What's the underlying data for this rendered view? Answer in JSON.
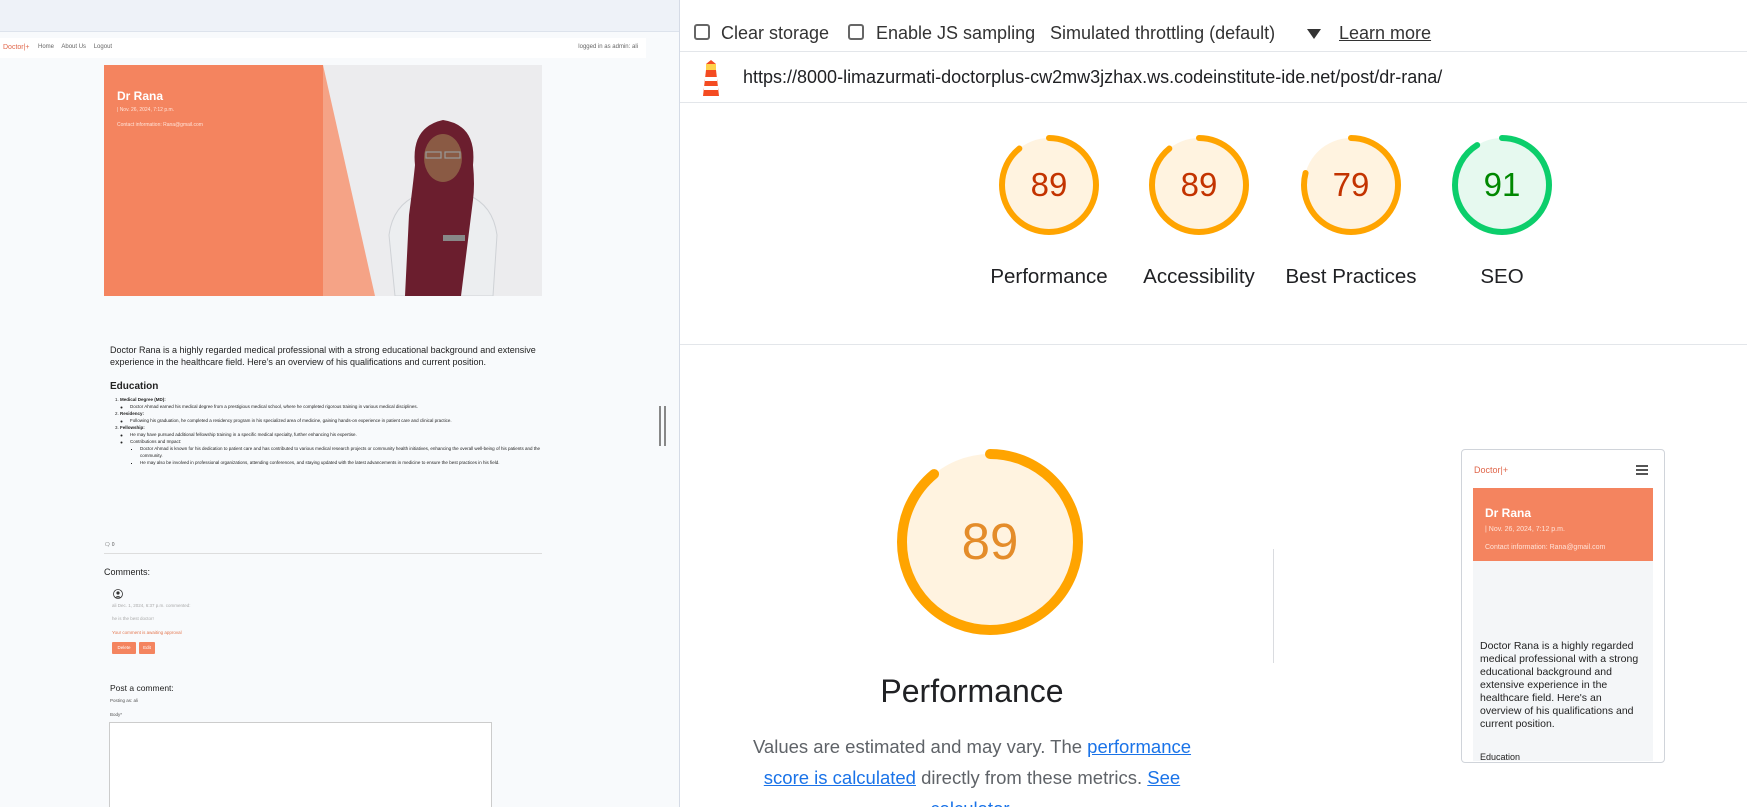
{
  "preview": {
    "nav": {
      "brand": "Doctor|+",
      "links": [
        "Home",
        "About Us",
        "Logout"
      ],
      "login_status": "logged in as admin: ali"
    },
    "hero": {
      "title": "Dr Rana",
      "date": "| Nov. 26, 2024, 7:12 p.m.",
      "contact": "Contact information: Rana@gmail.com"
    },
    "article": {
      "intro": "Doctor Rana is a highly regarded medical professional with a strong educational background and extensive experience in the healthcare field. Here’s an overview of his qualifications and current position.",
      "education_heading": "Education",
      "items": [
        {
          "title": "Medical Degree (MD):",
          "text": "Doctor Ahmad earned his medical degree from a prestigious medical school, where he completed rigorous training in various medical disciplines."
        },
        {
          "title": "Residency:",
          "text": "Following his graduation, he completed a residency program in his specialized area of medicine, gaining hands-on experience in patient care and clinical practice."
        },
        {
          "title": "Fellowship:",
          "text": "He may have pursued additional fellowship training in a specific medical specialty, further enhancing his expertise."
        }
      ],
      "contributions_heading": "Contributions and Impact:",
      "contributions": [
        "Doctor Ahmad is known for his dedication to patient care and has contributed to various medical research projects or community health initiatives, enhancing the overall well-being of his patients and the community.",
        "He may also be involved in professional organizations, attending conferences, and staying updated with the latest advancements in medicine to ensure the best practices in his field."
      ]
    },
    "likes": "0",
    "comments": {
      "heading": "Comments:",
      "meta": "ali Dec. 1, 2024, 6:37 p.m. commented:",
      "body": "he is the best doctor!",
      "awaiting": "Your comment is awaiting approval",
      "delete_label": "Delete",
      "edit_label": "Edit"
    },
    "post_comment": {
      "heading": "Post a comment:",
      "posting_as": "Posting as: ali",
      "body_label": "Body*"
    }
  },
  "lighthouse": {
    "options": {
      "clear_storage": "Clear storage",
      "enable_js_sampling": "Enable JS sampling",
      "throttling": "Simulated throttling (default)",
      "learn_more": "Learn more"
    },
    "url": "https://8000-limazurmati-doctorplus-cw2mw3jzhax.ws.codeinstitute-ide.net/post/dr-rana/",
    "scores": [
      {
        "label": "Performance",
        "value": 89,
        "color": "#ffa400",
        "bg": "#fff3e0",
        "text_color": "#c33300"
      },
      {
        "label": "Accessibility",
        "value": 89,
        "color": "#ffa400",
        "bg": "#fff3e0",
        "text_color": "#c33300"
      },
      {
        "label": "Best Practices",
        "value": 79,
        "color": "#ffa400",
        "bg": "#fff3e0",
        "text_color": "#c33300"
      },
      {
        "label": "SEO",
        "value": 91,
        "color": "#0cce6b",
        "bg": "#e6f9ef",
        "text_color": "#008800"
      }
    ],
    "detail": {
      "score": "89",
      "title": "Performance",
      "desc_prefix": "Values are estimated and may vary. The ",
      "desc_link": "performance score is calculated",
      "desc_middle": " directly from these metrics. ",
      "desc_link2": "See calculator."
    },
    "thumbnail": {
      "brand": "Doctor|+",
      "title": "Dr Rana",
      "date": "| Nov. 26, 2024, 7:12 p.m.",
      "contact": "Contact information: Rana@gmail.com",
      "intro": "Doctor Rana is a highly regarded medical professional with a strong educational background and extensive experience in the healthcare field. Here's an overview of his qualifications and current position.",
      "edu": "Education"
    }
  }
}
